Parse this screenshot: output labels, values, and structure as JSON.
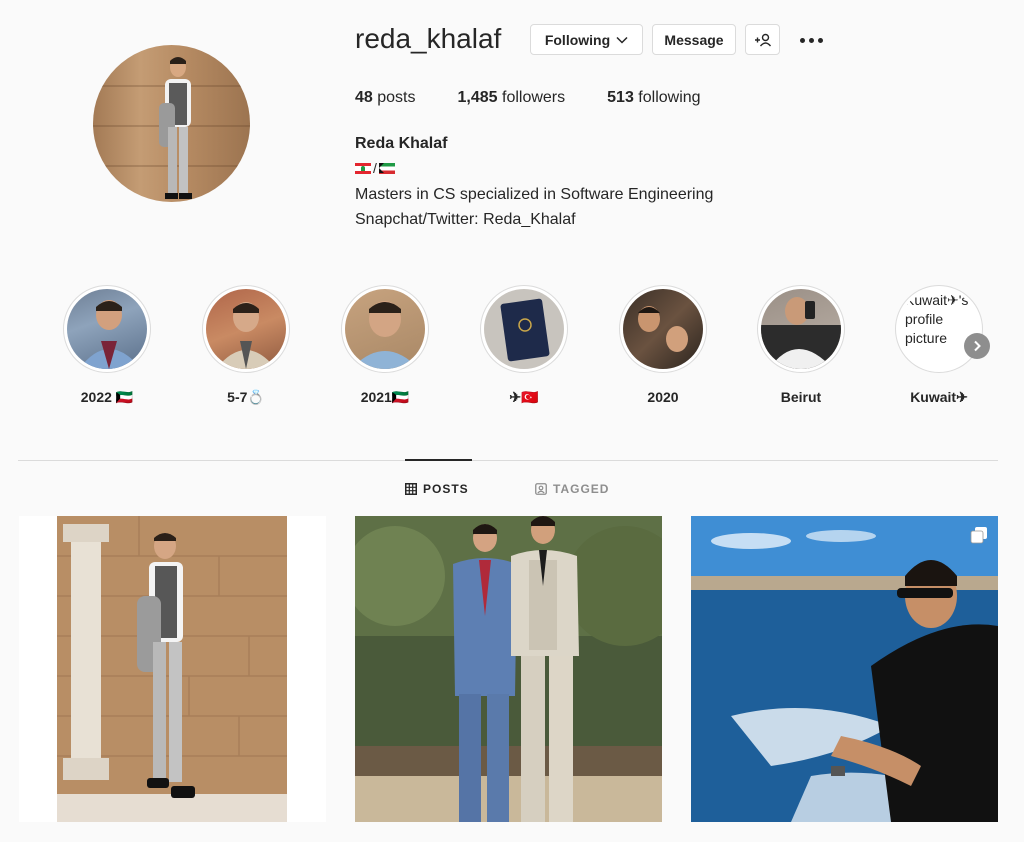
{
  "profile": {
    "username": "reda_khalaf",
    "full_name": "Reda Khalaf",
    "flags_separator": "/",
    "bio_line1": "Masters in CS specialized in Software Engineering",
    "bio_line2": "Snapchat/Twitter: Reda_Khalaf"
  },
  "actions": {
    "following_label": "Following",
    "message_label": "Message"
  },
  "stats": {
    "posts_count": "48",
    "posts_label": "posts",
    "followers_count": "1,485",
    "followers_label": "followers",
    "following_count": "513",
    "following_label": "following"
  },
  "highlights": [
    {
      "label": "2022 🇰🇼"
    },
    {
      "label": "5-7💍"
    },
    {
      "label": "2021🇰🇼"
    },
    {
      "label": "✈🇹🇷"
    },
    {
      "label": "2020"
    },
    {
      "label": "Beirut"
    },
    {
      "label": "Kuwait✈",
      "alt_text": "Kuwait✈'s profile picture"
    }
  ],
  "tabs": {
    "posts_label": "POSTS",
    "tagged_label": "TAGGED"
  },
  "colors": {
    "background": "#fafafa",
    "text": "#262626",
    "secondary_text": "#8e8e8e",
    "border": "#dbdbdb"
  }
}
